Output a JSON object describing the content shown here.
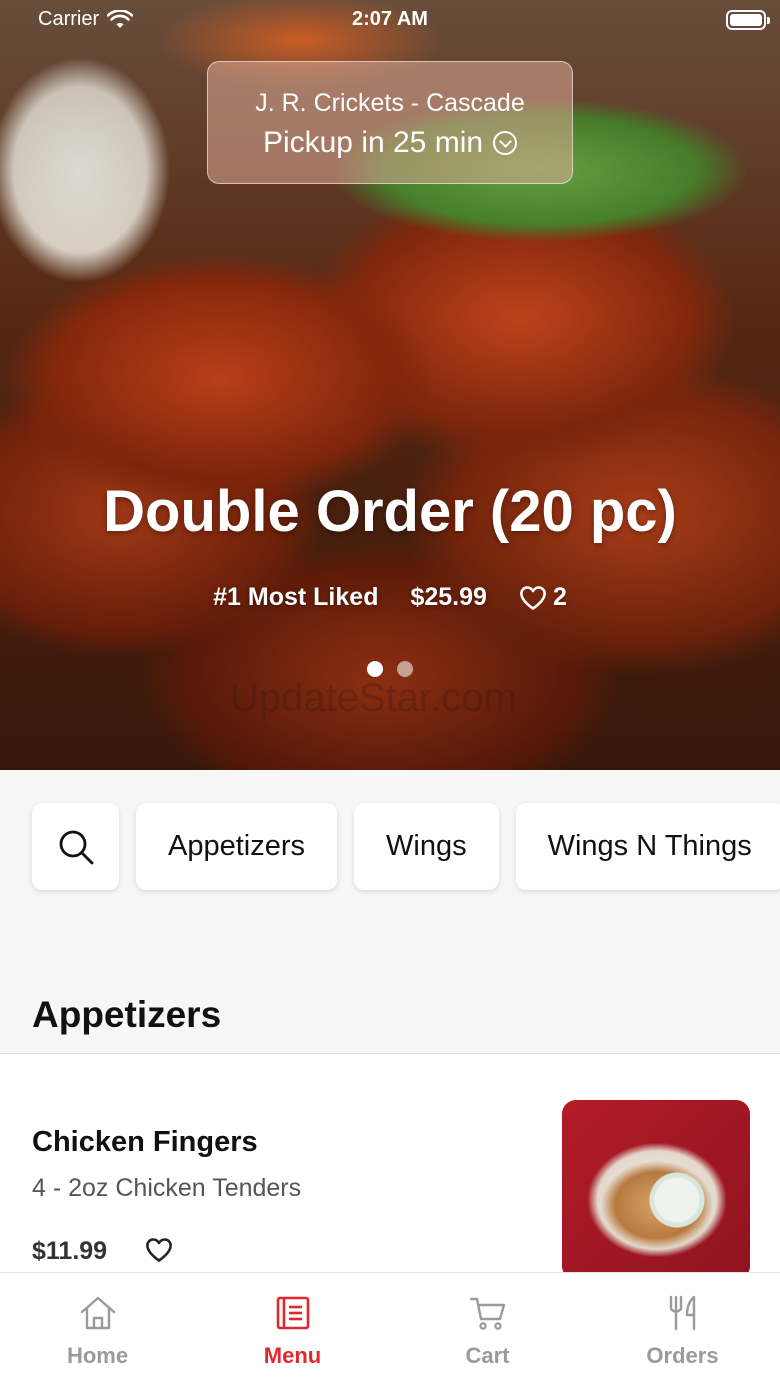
{
  "status_bar": {
    "carrier": "Carrier",
    "time": "2:07 AM"
  },
  "store": {
    "name": "J. R. Crickets - Cascade",
    "pickup": "Pickup in 25 min"
  },
  "featured": {
    "title": "Double Order (20 pc)",
    "badge": "#1 Most Liked",
    "price": "$25.99",
    "likes": "2",
    "page_index": 1,
    "page_count": 2
  },
  "watermark": "UpdateStar.com",
  "categories": [
    "Appetizers",
    "Wings",
    "Wings N Things"
  ],
  "section": {
    "title": "Appetizers"
  },
  "item": {
    "name": "Chicken Fingers",
    "description": "4 - 2oz Chicken Tenders",
    "price": "$11.99"
  },
  "tabs": [
    {
      "label": "Home",
      "icon": "home-icon",
      "active": false
    },
    {
      "label": "Menu",
      "icon": "menu-icon",
      "active": true
    },
    {
      "label": "Cart",
      "icon": "cart-icon",
      "active": false
    },
    {
      "label": "Orders",
      "icon": "fork-knife-icon",
      "active": false
    }
  ],
  "colors": {
    "accent": "#e0292f",
    "inactive_tab": "#9a9a9a",
    "background": "#f7f7f7"
  }
}
